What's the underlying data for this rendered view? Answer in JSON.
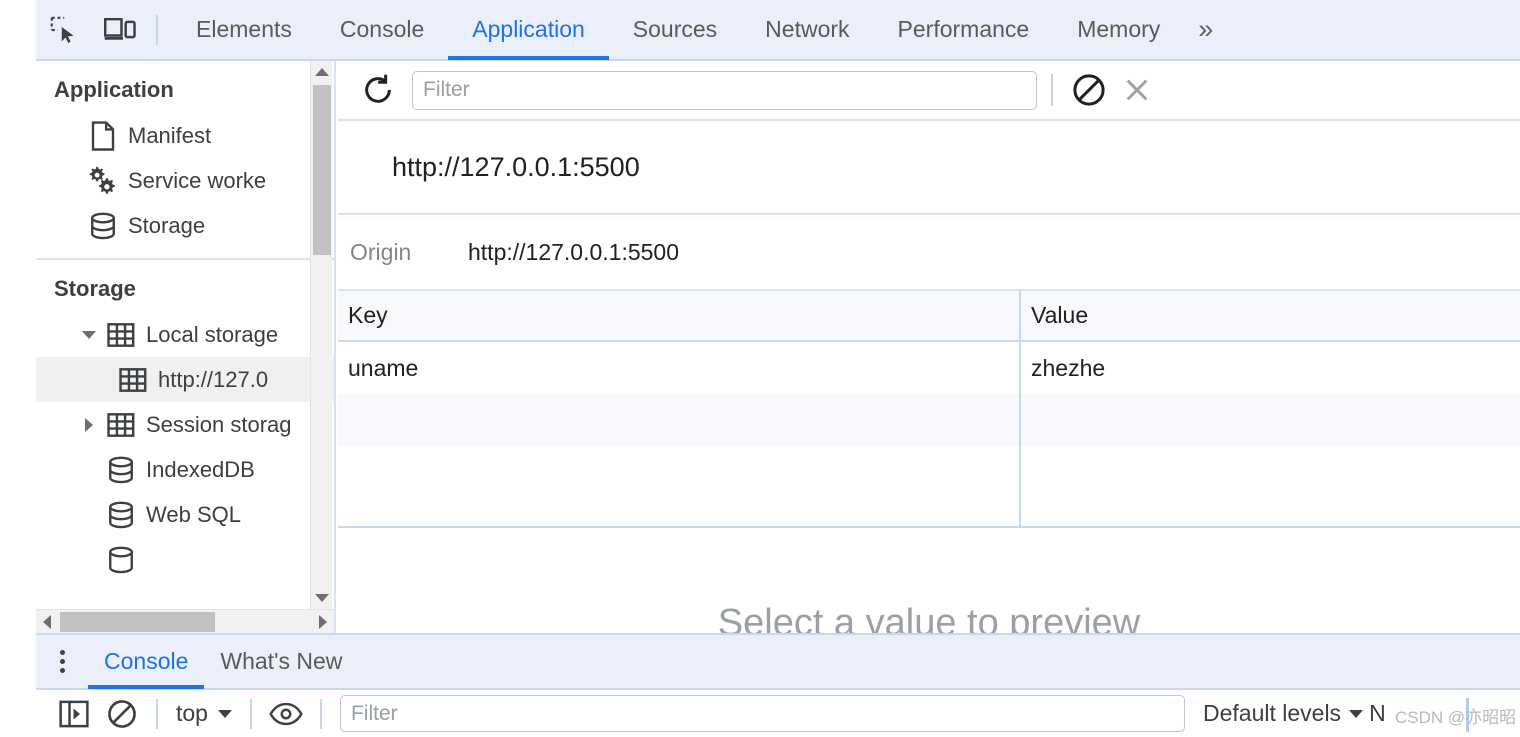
{
  "tabbar": {
    "inspect_icon": "inspect-element-icon",
    "device_icon": "device-toolbar-icon",
    "tabs": [
      {
        "label": "Elements",
        "active": false
      },
      {
        "label": "Console",
        "active": false
      },
      {
        "label": "Application",
        "active": true
      },
      {
        "label": "Sources",
        "active": false
      },
      {
        "label": "Network",
        "active": false
      },
      {
        "label": "Performance",
        "active": false
      },
      {
        "label": "Memory",
        "active": false
      }
    ],
    "more_label": "»"
  },
  "sidebar": {
    "application": {
      "title": "Application",
      "items": [
        {
          "label": "Manifest",
          "icon": "document-icon"
        },
        {
          "label": "Service worke",
          "icon": "gears-icon"
        },
        {
          "label": "Storage",
          "icon": "database-icon"
        }
      ]
    },
    "storage": {
      "title": "Storage",
      "items": [
        {
          "label": "Local storage",
          "icon": "table-icon",
          "twisty": "expanded"
        },
        {
          "label": "http://127.0",
          "icon": "table-icon",
          "selected": true
        },
        {
          "label": "Session storag",
          "icon": "table-icon",
          "twisty": "collapsed"
        },
        {
          "label": "IndexedDB",
          "icon": "database-icon"
        },
        {
          "label": "Web SQL",
          "icon": "database-icon"
        }
      ]
    }
  },
  "panel": {
    "toolbar": {
      "refresh_icon": "refresh-icon",
      "filter_placeholder": "Filter",
      "filter_value": "",
      "clear_icon": "clear-all-icon",
      "close_icon": "close-icon"
    },
    "origin_title": "http://127.0.0.1:5500",
    "origin_label": "Origin",
    "origin_value": "http://127.0.0.1:5500",
    "table": {
      "columns": [
        "Key",
        "Value"
      ],
      "rows": [
        {
          "key": "uname",
          "value": "zhezhe"
        },
        {
          "key": "",
          "value": ""
        },
        {
          "key": "",
          "value": ""
        }
      ]
    },
    "preview_placeholder": "Select a value to preview"
  },
  "drawer": {
    "menu_icon": "more-options-icon",
    "tabs": [
      {
        "label": "Console",
        "active": true
      },
      {
        "label": "What's New",
        "active": false
      }
    ],
    "console_toolbar": {
      "sidebar_icon": "console-sidebar-icon",
      "clear_icon": "clear-console-icon",
      "context_value": "top",
      "eye_icon": "live-expression-icon",
      "filter_placeholder": "Filter",
      "filter_value": "",
      "levels_label": "Default levels",
      "issues_label": "N"
    }
  },
  "watermark": {
    "text": "CSDN @亦昭昭"
  },
  "colors": {
    "accent": "#1a73e8",
    "tabbar_bg": "#ebeffa",
    "border": "#d8e2f5",
    "selected_row": "#f0f0f0",
    "table_stripe": "#f7f9fd"
  }
}
